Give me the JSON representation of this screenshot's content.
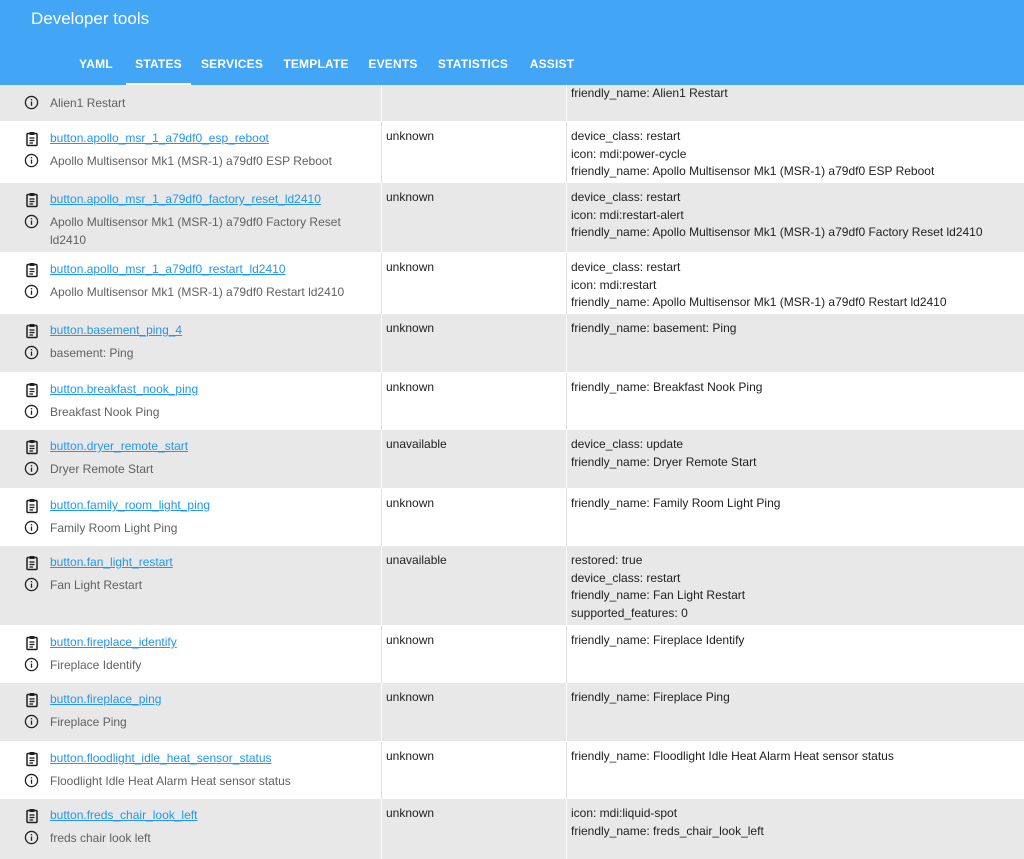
{
  "header": {
    "title": "Developer tools",
    "tabs": [
      {
        "label": "YAML",
        "active": false
      },
      {
        "label": "STATES",
        "active": true
      },
      {
        "label": "SERVICES",
        "active": false
      },
      {
        "label": "TEMPLATE",
        "active": false
      },
      {
        "label": "EVENTS",
        "active": false
      },
      {
        "label": "STATISTICS",
        "active": false
      },
      {
        "label": "ASSIST",
        "active": false
      }
    ]
  },
  "rows": [
    {
      "entity": "",
      "friendly": "Alien1 Restart",
      "state": "",
      "attributes": [
        "friendly_name: Alien1 Restart"
      ],
      "partial_top": true
    },
    {
      "entity": "button.apollo_msr_1_a79df0_esp_reboot",
      "friendly": "Apollo Multisensor Mk1 (MSR-1) a79df0 ESP Reboot",
      "state": "unknown",
      "attributes": [
        "device_class: restart",
        "icon: mdi:power-cycle",
        "friendly_name: Apollo Multisensor Mk1 (MSR-1) a79df0 ESP Reboot"
      ]
    },
    {
      "entity": "button.apollo_msr_1_a79df0_factory_reset_ld2410",
      "friendly": "Apollo Multisensor Mk1 (MSR-1) a79df0 Factory Reset ld2410",
      "state": "unknown",
      "attributes": [
        "device_class: restart",
        "icon: mdi:restart-alert",
        "friendly_name: Apollo Multisensor Mk1 (MSR-1) a79df0 Factory Reset ld2410"
      ]
    },
    {
      "entity": "button.apollo_msr_1_a79df0_restart_ld2410",
      "friendly": "Apollo Multisensor Mk1 (MSR-1) a79df0 Restart ld2410",
      "state": "unknown",
      "attributes": [
        "device_class: restart",
        "icon: mdi:restart",
        "friendly_name: Apollo Multisensor Mk1 (MSR-1) a79df0 Restart ld2410"
      ]
    },
    {
      "entity": "button.basement_ping_4",
      "friendly": "basement: Ping",
      "state": "unknown",
      "attributes": [
        "friendly_name: basement: Ping"
      ]
    },
    {
      "entity": "button.breakfast_nook_ping",
      "friendly": "Breakfast Nook Ping",
      "state": "unknown",
      "attributes": [
        "friendly_name: Breakfast Nook Ping"
      ]
    },
    {
      "entity": "button.dryer_remote_start",
      "friendly": "Dryer Remote Start",
      "state": "unavailable",
      "attributes": [
        "device_class: update",
        "friendly_name: Dryer Remote Start"
      ]
    },
    {
      "entity": "button.family_room_light_ping",
      "friendly": "Family Room Light Ping",
      "state": "unknown",
      "attributes": [
        "friendly_name: Family Room Light Ping"
      ]
    },
    {
      "entity": "button.fan_light_restart",
      "friendly": "Fan Light Restart",
      "state": "unavailable",
      "attributes": [
        "restored: true",
        "device_class: restart",
        "friendly_name: Fan Light Restart",
        "supported_features: 0"
      ]
    },
    {
      "entity": "button.fireplace_identify",
      "friendly": "Fireplace Identify",
      "state": "unknown",
      "attributes": [
        "friendly_name: Fireplace Identify"
      ]
    },
    {
      "entity": "button.fireplace_ping",
      "friendly": "Fireplace Ping",
      "state": "unknown",
      "attributes": [
        "friendly_name: Fireplace Ping"
      ]
    },
    {
      "entity": "button.floodlight_idle_heat_sensor_status",
      "friendly": "Floodlight Idle Heat Alarm Heat sensor status",
      "state": "unknown",
      "attributes": [
        "friendly_name: Floodlight Idle Heat Alarm Heat sensor status"
      ]
    },
    {
      "entity": "button.freds_chair_look_left",
      "friendly": "freds chair look left",
      "state": "unknown",
      "attributes": [
        "icon: mdi:liquid-spot",
        "friendly_name: freds_chair_look_left"
      ]
    }
  ]
}
